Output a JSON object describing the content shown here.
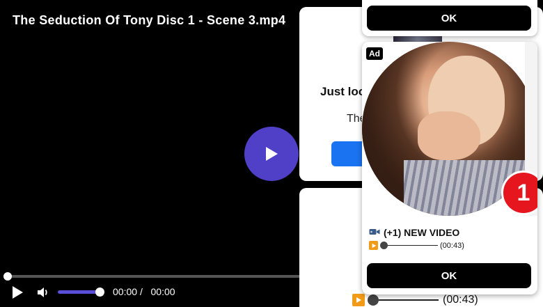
{
  "player": {
    "title": "The Seduction Of Tony Disc 1 - Scene 3.mp4",
    "current_time": "00:00",
    "separator": "/",
    "duration": "00:00",
    "progress": 0,
    "volume": 1.0
  },
  "background_dialog": {
    "heading": "Just loo",
    "text": "The"
  },
  "background_bottom": {
    "duration": "(00:43)"
  },
  "notification_top": {
    "ok_label": "OK"
  },
  "ad": {
    "badge": "Ad",
    "count": "1",
    "title_icon": "video-camera-icon",
    "title": "(+1) NEW VIDEO",
    "duration": "(00:43)",
    "ok_label": "OK"
  },
  "colors": {
    "accent_play": "#5040c8",
    "volume_fill": "#5a4fd8",
    "cta_blue": "#1a73f0",
    "badge_red": "#e5161d",
    "play_orange": "#f29b18"
  }
}
